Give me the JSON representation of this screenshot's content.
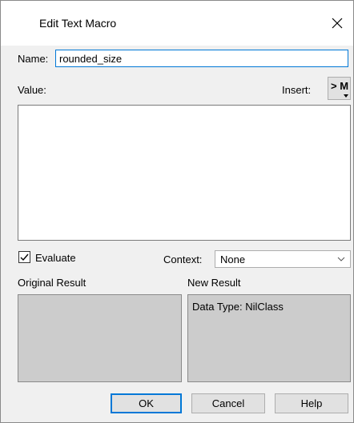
{
  "dialog": {
    "title": "Edit Text Macro"
  },
  "name": {
    "label": "Name:",
    "value": "rounded_size"
  },
  "value_section": {
    "label": "Value:",
    "insert_label": "Insert:",
    "insert_button_label": "> M",
    "text": ""
  },
  "evaluate": {
    "label": "Evaluate",
    "checked": true
  },
  "context": {
    "label": "Context:",
    "selected": "None"
  },
  "results": {
    "original_label": "Original Result",
    "original_text": "",
    "new_label": "New Result",
    "new_text": "Data Type: NilClass"
  },
  "buttons": {
    "ok": "OK",
    "cancel": "Cancel",
    "help": "Help"
  },
  "icons": {
    "close": "close-icon",
    "check": "checkmark-icon",
    "chevron": "chevron-down-icon",
    "insert_arrow": "dropdown-arrow-icon"
  },
  "colors": {
    "accent": "#0078d7",
    "result_bg": "#cccccc",
    "dialog_bg": "#f0f0f0"
  }
}
